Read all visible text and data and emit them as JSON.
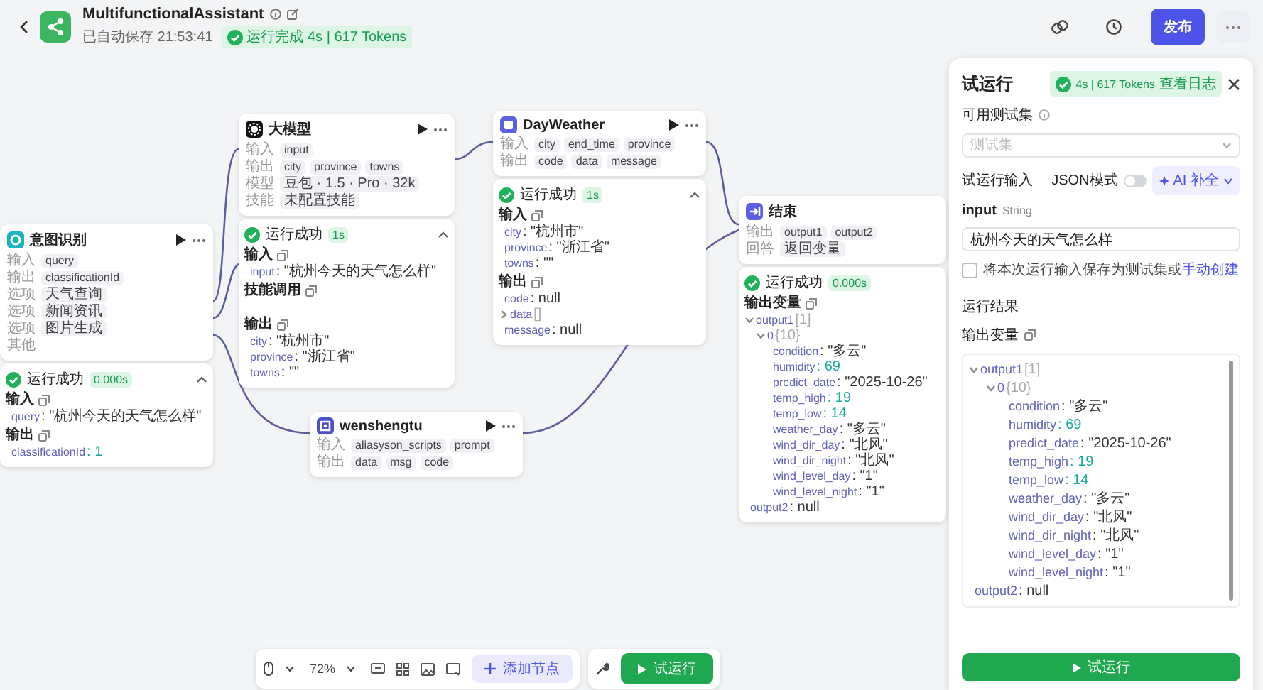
{
  "header": {
    "title": "MultifunctionalAssistant",
    "saved": "已自动保存 21:53:41",
    "run_status": "运行完成 4s | 617 Tokens",
    "publish": "发布"
  },
  "nodes": [
    {
      "kind": "intent",
      "title": "意图识别",
      "rows": [
        {
          "label": "输入",
          "tags": [
            "query"
          ]
        },
        {
          "label": "输出",
          "tags": [
            "classificationId"
          ]
        },
        {
          "label": "选项",
          "tags": [
            "天气查询"
          ]
        },
        {
          "label": "选项",
          "tags": [
            "新闻资讯"
          ]
        },
        {
          "label": "选项",
          "tags": [
            "图片生成"
          ]
        },
        {
          "label": "其他"
        }
      ],
      "result": {
        "status": "运行成功",
        "time": "0.000s",
        "expanded": true,
        "sections": [
          {
            "heading": "输入",
            "items": [
              {
                "key": "query",
                "value": ": \"杭州今天的天气怎么样\"",
                "kind": "string"
              }
            ]
          },
          {
            "heading": "输出",
            "items": [
              {
                "key": "classificationId",
                "value": ": 1",
                "kind": "number"
              }
            ]
          }
        ]
      }
    },
    {
      "kind": "llm",
      "title": "大模型",
      "rows": [
        {
          "label": "输入",
          "tags": [
            "input"
          ]
        },
        {
          "label": "输出",
          "tags": [
            "city",
            "province",
            "towns"
          ]
        },
        {
          "label": "模型",
          "tags": [
            "豆包 · 1.5 · Pro · 32k"
          ]
        },
        {
          "label": "技能",
          "tags": [
            "未配置技能"
          ]
        }
      ],
      "result": {
        "status": "运行成功",
        "time": "1s",
        "expanded": true,
        "sections": [
          {
            "heading": "输入",
            "items": [
              {
                "key": "input",
                "value": ": \"杭州今天的天气怎么样\"",
                "kind": "string"
              }
            ]
          },
          {
            "heading": "技能调用"
          },
          {
            "heading": "输出",
            "items": [
              {
                "key": "city",
                "value": ": \"杭州市\"",
                "kind": "string"
              },
              {
                "key": "province",
                "value": ": \"浙江省\"",
                "kind": "string"
              },
              {
                "key": "towns",
                "value": ": \"\"",
                "kind": "string"
              }
            ]
          }
        ]
      }
    },
    {
      "kind": "plugin",
      "title": "DayWeather",
      "rows": [
        {
          "label": "输入",
          "tags": [
            "city",
            "end_time",
            "province"
          ]
        },
        {
          "label": "输出",
          "tags": [
            "code",
            "data",
            "message"
          ]
        }
      ],
      "result": {
        "status": "运行成功",
        "time": "1s",
        "expanded": true,
        "sections": [
          {
            "heading": "输入",
            "items": [
              {
                "key": "city",
                "value": ": \"杭州市\"",
                "kind": "string"
              },
              {
                "key": "province",
                "value": ": \"浙江省\"",
                "kind": "string"
              },
              {
                "key": "towns",
                "value": ": \"\"",
                "kind": "string"
              }
            ]
          },
          {
            "heading": "输出",
            "items": [
              {
                "key": "code",
                "value": ": null",
                "kind": "null"
              },
              {
                "key": "data",
                "value": "[]",
                "kind": "count",
                "expanded": false
              },
              {
                "key": "message",
                "value": ": null",
                "kind": "null"
              }
            ]
          }
        ]
      }
    },
    {
      "kind": "workflow",
      "title": "wenshengtu",
      "rows": [
        {
          "label": "输入",
          "tags": [
            "aliasyson_scripts",
            "prompt"
          ]
        },
        {
          "label": "输出",
          "tags": [
            "data",
            "msg",
            "code"
          ]
        }
      ]
    },
    {
      "kind": "end",
      "title": "结束",
      "rows": [
        {
          "label": "输出",
          "tags": [
            "output1",
            "output2"
          ]
        },
        {
          "label": "回答",
          "tags": [
            "返回变量"
          ]
        }
      ],
      "result": {
        "status": "运行成功",
        "time": "0.000s",
        "sections": [
          {
            "heading": "输出变量",
            "items": [
              {
                "key": "output1",
                "value": "[1]",
                "kind": "count",
                "expanded": true,
                "children": [
                  {
                    "key": "0",
                    "value": "{10}",
                    "kind": "count",
                    "expanded": true,
                    "children": [
                      {
                        "key": "condition",
                        "value": ": \"多云\"",
                        "kind": "string"
                      },
                      {
                        "key": "humidity",
                        "value": ": 69",
                        "kind": "number"
                      },
                      {
                        "key": "predict_date",
                        "value": ": \"2025-10-26\"",
                        "kind": "string"
                      },
                      {
                        "key": "temp_high",
                        "value": ": 19",
                        "kind": "number"
                      },
                      {
                        "key": "temp_low",
                        "value": ": 14",
                        "kind": "number"
                      },
                      {
                        "key": "weather_day",
                        "value": ": \"多云\"",
                        "kind": "string"
                      },
                      {
                        "key": "wind_dir_day",
                        "value": ": \"北风\"",
                        "kind": "string"
                      },
                      {
                        "key": "wind_dir_night",
                        "value": ": \"北风\"",
                        "kind": "string"
                      },
                      {
                        "key": "wind_level_day",
                        "value": ": \"1\"",
                        "kind": "string"
                      },
                      {
                        "key": "wind_level_night",
                        "value": ": \"1\"",
                        "kind": "string"
                      }
                    ]
                  }
                ]
              },
              {
                "key": "output2",
                "value": ": null",
                "kind": "null"
              }
            ]
          }
        ]
      }
    }
  ],
  "run_panel": {
    "title": "试运行",
    "status": "4s | 617 Tokens",
    "log_link": "查看日志",
    "testset_label": "可用测试集",
    "testset_placeholder": "测试集",
    "input_heading": "试运行输入",
    "json_mode": {
      "label": "JSON模式",
      "on": false
    },
    "ai_button": "AI 补全",
    "input_name": "input",
    "input_type": "String",
    "input_value": "杭州今天的天气怎么样",
    "save_option": {
      "text": "将本次运行输入保存为测试集或",
      "link": "手动创建",
      "checked": false
    },
    "results_heading": "运行结果",
    "output_heading": "输出变量",
    "output_tree": [
      {
        "key": "output1",
        "value": "[1]",
        "kind": "count",
        "expanded": true,
        "children": [
          {
            "key": "0",
            "value": "{10}",
            "kind": "count",
            "expanded": true,
            "children": [
              {
                "key": "condition",
                "value": ": \"多云\"",
                "kind": "string"
              },
              {
                "key": "humidity",
                "value": ": 69",
                "kind": "number"
              },
              {
                "key": "predict_date",
                "value": ": \"2025-10-26\"",
                "kind": "string"
              },
              {
                "key": "temp_high",
                "value": ": 19",
                "kind": "number"
              },
              {
                "key": "temp_low",
                "value": ": 14",
                "kind": "number"
              },
              {
                "key": "weather_day",
                "value": ": \"多云\"",
                "kind": "string"
              },
              {
                "key": "wind_dir_day",
                "value": ": \"北风\"",
                "kind": "string"
              },
              {
                "key": "wind_dir_night",
                "value": ": \"北风\"",
                "kind": "string"
              },
              {
                "key": "wind_level_day",
                "value": ": \"1\"",
                "kind": "string"
              },
              {
                "key": "wind_level_night",
                "value": ": \"1\"",
                "kind": "string"
              }
            ]
          }
        ]
      },
      {
        "key": "output2",
        "value": ": null",
        "kind": "null"
      }
    ],
    "run_button": "试运行"
  },
  "toolbar": {
    "zoom": "72%",
    "add_node": "添加节点",
    "run": "试运行"
  }
}
